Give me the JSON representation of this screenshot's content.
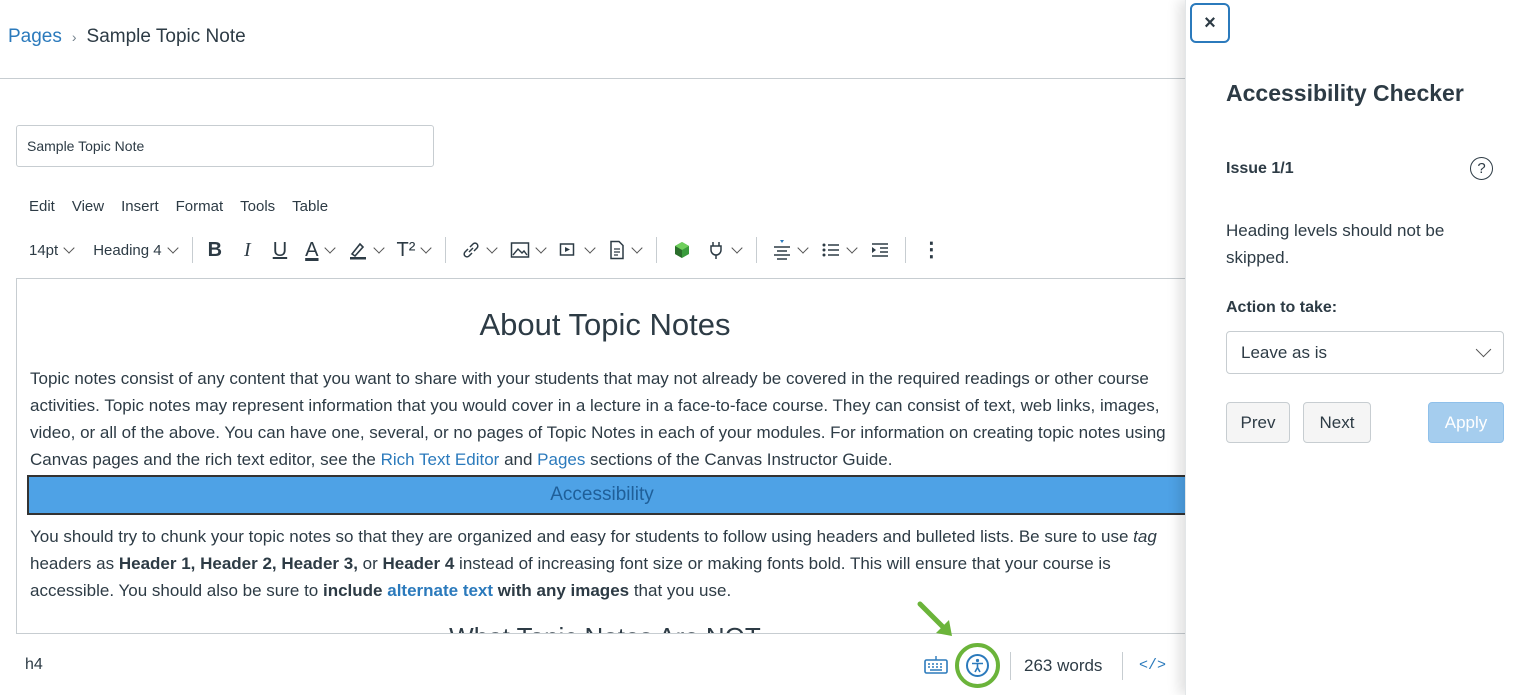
{
  "breadcrumb": {
    "parent": "Pages",
    "current": "Sample Topic Note"
  },
  "title_input": {
    "value": "Sample Topic Note"
  },
  "menubar": [
    "Edit",
    "View",
    "Insert",
    "Format",
    "Tools",
    "Table"
  ],
  "toolbar": {
    "font_size": "14pt",
    "block_format": "Heading 4"
  },
  "document": {
    "heading": "About Topic Notes",
    "para1_a": "Topic notes consist of any content that you want to share with your students that may not already be covered in the required readings or other course activities. Topic notes may represent information that you would cover in a lecture in a face-to-face course.  They can consist of text, web links, images, video, or all of the above. You can have one, several, or no pages of Topic Notes in each of your modules. For information on creating topic notes using Canvas pages and the rich text editor, see the ",
    "link_rte": "Rich Text Editor",
    "para1_b": " and ",
    "link_pages": "Pages",
    "para1_c": " sections of the Canvas Instructor Guide.",
    "banner": "Accessibility",
    "para2_a": "You should try to chunk your topic notes so that they are organized and easy for students to follow using headers and bulleted lists. Be sure to use ",
    "para2_tag": "tag",
    "para2_b": " headers as ",
    "para2_headers": "Header 1, Header 2, Header 3,",
    "para2_c": " or ",
    "para2_header4": "Header 4",
    "para2_d": " instead of increasing font size or making fonts bold. This will ensure that your course is accessible. You should also be sure to ",
    "para2_include": "include",
    "link_alt": "alternate text",
    "para2_with": " with any images",
    "para2_e": " that you use.",
    "cut_heading": "What Topic Notes Are NOT"
  },
  "statusbar": {
    "path": "h4",
    "word_count": "263 words",
    "html_toggle": "</>"
  },
  "tray": {
    "close": "×",
    "title": "Accessibility Checker",
    "issue_count": "Issue 1/1",
    "help": "?",
    "message": "Heading levels should not be skipped.",
    "action_label": "Action to take:",
    "action_value": "Leave as is",
    "prev": "Prev",
    "next": "Next",
    "apply": "Apply"
  },
  "colors": {
    "link": "#2b7abc",
    "highlight_ring": "#6bb43a",
    "banner": "#4ea2e6",
    "apply_disabled": "#a5cdee"
  }
}
